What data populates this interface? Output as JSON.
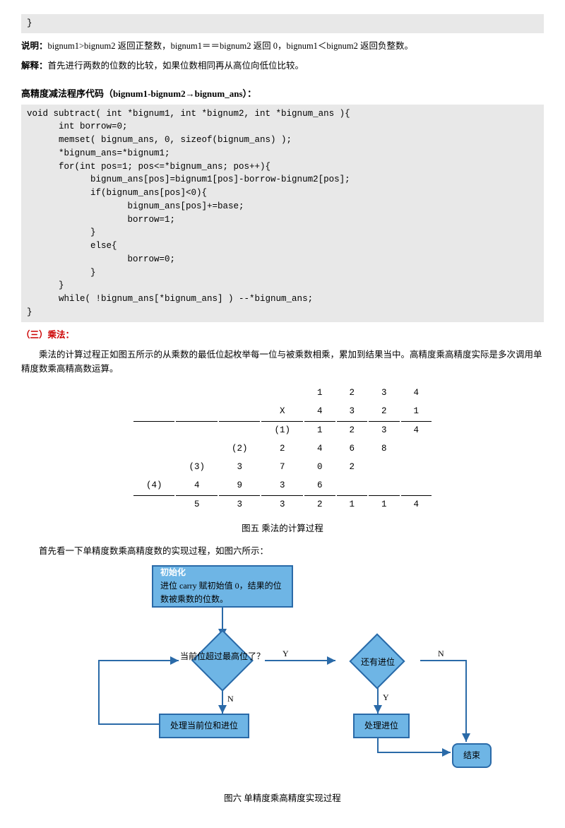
{
  "code1": "}",
  "note1_label": "说明：",
  "note1_text": "bignum1>bignum2 返回正整数，bignum1＝＝bignum2 返回 0，bignum1＜bignum2 返回负整数。",
  "note2_label": "解释：",
  "note2_text": "首先进行两数的位数的比较，如果位数相同再从高位向低位比较。",
  "section_sub": "高精度减法程序代码（bignum1-bignum2→bignum_ans）：",
  "code2": "void subtract( int *bignum1, int *bignum2, int *bignum_ans ){\n      int borrow=0;\n      memset( bignum_ans, 0, sizeof(bignum_ans) );\n      *bignum_ans=*bignum1;\n      for(int pos=1; pos<=*bignum_ans; pos++){\n            bignum_ans[pos]=bignum1[pos]-borrow-bignum2[pos];\n            if(bignum_ans[pos]<0){\n                   bignum_ans[pos]+=base;\n                   borrow=1;\n            }\n            else{\n                   borrow=0;\n            }\n      }\n      while( !bignum_ans[*bignum_ans] ) --*bignum_ans;\n}",
  "section_mult": "（三）乘法：",
  "mult_para": "乘法的计算过程正如图五所示的从乘数的最低位起枚举每一位与被乘数相乘，累加到结果当中。高精度乘高精度实际是多次调用单精度数乘高精高数运算。",
  "mult_table": {
    "r1": [
      "",
      "",
      "",
      "",
      "1",
      "2",
      "3",
      "4"
    ],
    "r2": [
      "",
      "",
      "",
      "X",
      "4",
      "3",
      "2",
      "1"
    ],
    "r3": [
      "",
      "",
      "",
      "(1)",
      "1",
      "2",
      "3",
      "4"
    ],
    "r4": [
      "",
      "",
      "(2)",
      "2",
      "4",
      "6",
      "8",
      ""
    ],
    "r5": [
      "",
      "(3)",
      "3",
      "7",
      "0",
      "2",
      "",
      ""
    ],
    "r6": [
      "(4)",
      "4",
      "9",
      "3",
      "6",
      "",
      "",
      ""
    ],
    "r7": [
      "",
      "5",
      "3",
      "3",
      "2",
      "1",
      "1",
      "4"
    ]
  },
  "fig5": "图五  乘法的计算过程",
  "mult_para2": "首先看一下单精度数乘高精度数的实现过程，如图六所示：",
  "flow": {
    "init_title": "初始化",
    "init_text": "  进位 carry 赋初始值 0，结果的位数被乘数的位数。",
    "d1": "当前位超过最高位了？",
    "d2": "还有进位",
    "p1": "处理当前位和进位",
    "p2": "处理进位",
    "end": "结束",
    "Y": "Y",
    "N": "N"
  },
  "fig6": "图六  单精度乘高精度实现过程"
}
